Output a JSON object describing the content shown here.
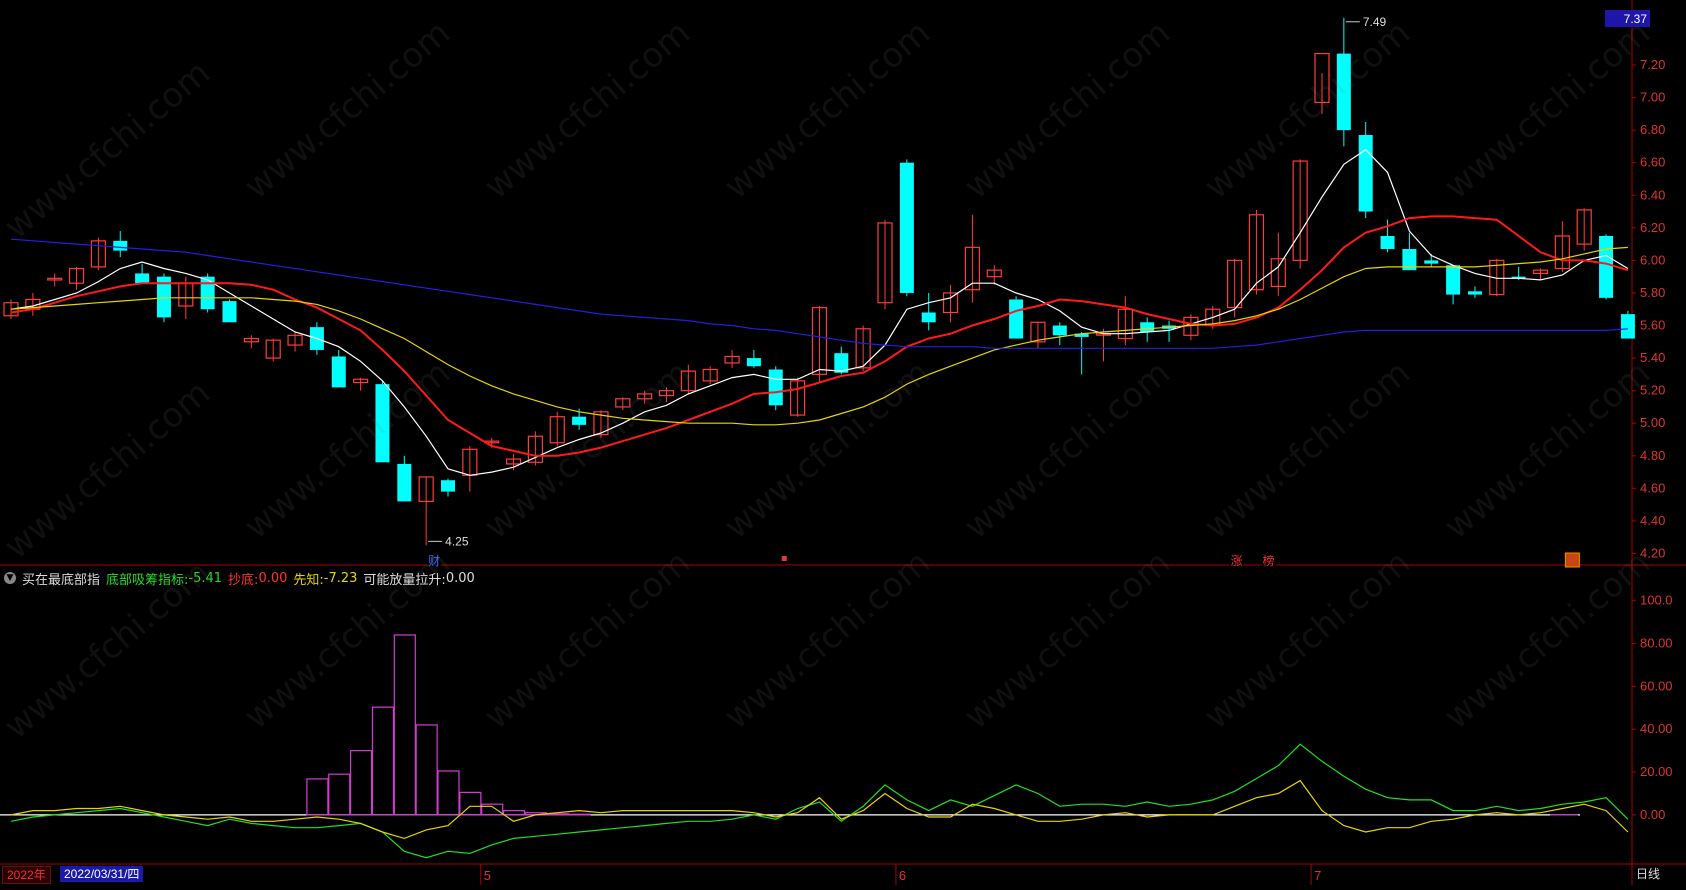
{
  "chart_data": [
    {
      "type": "candlestick",
      "y_axis": {
        "ticks": [
          "7.20",
          "7.00",
          "6.80",
          "6.60",
          "6.40",
          "6.20",
          "6.00",
          "5.80",
          "5.60",
          "5.40",
          "5.20",
          "5.00",
          "4.80",
          "4.60",
          "4.40",
          "4.20"
        ],
        "ylim": [
          4.16,
          7.55
        ]
      },
      "last_price": "7.37",
      "annotations": {
        "high": "7.49",
        "low": "4.25"
      },
      "event_markers": [
        "财",
        "",
        "涨",
        "榜",
        "预"
      ],
      "candles": [
        [
          5.66,
          5.76,
          5.64,
          5.74
        ],
        [
          5.7,
          5.8,
          5.66,
          5.76
        ],
        [
          5.88,
          5.92,
          5.84,
          5.89
        ],
        [
          5.86,
          5.96,
          5.82,
          5.95
        ],
        [
          5.96,
          6.14,
          5.94,
          6.12
        ],
        [
          6.12,
          6.18,
          6.02,
          6.06
        ],
        [
          5.92,
          5.98,
          5.86,
          5.86
        ],
        [
          5.9,
          5.92,
          5.62,
          5.65
        ],
        [
          5.72,
          5.9,
          5.64,
          5.86
        ],
        [
          5.9,
          5.92,
          5.68,
          5.7
        ],
        [
          5.75,
          5.76,
          5.62,
          5.62
        ],
        [
          5.5,
          5.54,
          5.46,
          5.52
        ],
        [
          5.4,
          5.52,
          5.38,
          5.51
        ],
        [
          5.48,
          5.56,
          5.44,
          5.54
        ],
        [
          5.59,
          5.62,
          5.42,
          5.45
        ],
        [
          5.41,
          5.45,
          5.22,
          5.22
        ],
        [
          5.25,
          5.28,
          5.2,
          5.27
        ],
        [
          5.24,
          5.26,
          4.76,
          4.76
        ],
        [
          4.75,
          4.8,
          4.52,
          4.52
        ],
        [
          4.52,
          4.67,
          4.25,
          4.67
        ],
        [
          4.65,
          4.66,
          4.55,
          4.58
        ],
        [
          4.68,
          4.86,
          4.58,
          4.84
        ],
        [
          4.88,
          4.91,
          4.85,
          4.89
        ],
        [
          4.75,
          4.81,
          4.71,
          4.78
        ],
        [
          4.76,
          4.95,
          4.74,
          4.92
        ],
        [
          4.88,
          5.07,
          4.86,
          5.04
        ],
        [
          5.04,
          5.09,
          4.96,
          4.99
        ],
        [
          4.93,
          5.08,
          4.91,
          5.07
        ],
        [
          5.1,
          5.16,
          5.08,
          5.15
        ],
        [
          5.15,
          5.2,
          5.12,
          5.18
        ],
        [
          5.17,
          5.22,
          5.13,
          5.2
        ],
        [
          5.2,
          5.36,
          5.18,
          5.32
        ],
        [
          5.26,
          5.35,
          5.24,
          5.33
        ],
        [
          5.37,
          5.45,
          5.34,
          5.41
        ],
        [
          5.4,
          5.45,
          5.34,
          5.35
        ],
        [
          5.33,
          5.35,
          5.08,
          5.11
        ],
        [
          5.05,
          5.28,
          5.04,
          5.26
        ],
        [
          5.3,
          5.72,
          5.25,
          5.71
        ],
        [
          5.43,
          5.47,
          5.3,
          5.31
        ],
        [
          5.34,
          5.6,
          5.32,
          5.58
        ],
        [
          5.74,
          6.25,
          5.7,
          6.23
        ],
        [
          6.6,
          6.62,
          5.78,
          5.8
        ],
        [
          5.68,
          5.8,
          5.57,
          5.62
        ],
        [
          5.68,
          5.85,
          5.62,
          5.8
        ],
        [
          5.82,
          6.28,
          5.74,
          6.08
        ],
        [
          5.9,
          5.97,
          5.85,
          5.94
        ],
        [
          5.76,
          5.78,
          5.52,
          5.52
        ],
        [
          5.5,
          5.62,
          5.46,
          5.62
        ],
        [
          5.6,
          5.62,
          5.48,
          5.54
        ],
        [
          5.55,
          5.56,
          5.3,
          5.53
        ],
        [
          5.55,
          5.58,
          5.38,
          5.55
        ],
        [
          5.52,
          5.78,
          5.48,
          5.7
        ],
        [
          5.62,
          5.65,
          5.5,
          5.56
        ],
        [
          5.6,
          5.63,
          5.5,
          5.58
        ],
        [
          5.54,
          5.67,
          5.51,
          5.65
        ],
        [
          5.6,
          5.72,
          5.58,
          5.7
        ],
        [
          5.71,
          6.01,
          5.65,
          6.0
        ],
        [
          5.82,
          6.31,
          5.79,
          6.28
        ],
        [
          5.84,
          6.17,
          5.78,
          6.01
        ],
        [
          6.0,
          6.62,
          5.95,
          6.61
        ],
        [
          6.97,
          7.15,
          6.9,
          7.27
        ],
        [
          7.27,
          7.49,
          6.7,
          6.8
        ],
        [
          6.77,
          6.85,
          6.26,
          6.3
        ],
        [
          6.15,
          6.25,
          6.05,
          6.07
        ],
        [
          6.07,
          6.17,
          5.94,
          5.94
        ],
        [
          6.0,
          6.04,
          5.96,
          5.98
        ],
        [
          5.97,
          5.97,
          5.73,
          5.79
        ],
        [
          5.81,
          5.84,
          5.77,
          5.79
        ],
        [
          5.79,
          6.01,
          5.78,
          6.0
        ],
        [
          5.9,
          5.96,
          5.88,
          5.89
        ],
        [
          5.92,
          5.95,
          5.88,
          5.94
        ],
        [
          5.95,
          6.24,
          5.93,
          6.15
        ],
        [
          6.1,
          6.32,
          6.06,
          6.31
        ],
        [
          6.15,
          6.16,
          5.76,
          5.77
        ],
        [
          5.67,
          5.69,
          5.52,
          5.52
        ]
      ],
      "moving_averages": [
        {
          "color": "#ffffff",
          "values": [
            5.7,
            5.72,
            5.76,
            5.8,
            5.87,
            5.95,
            5.99,
            5.95,
            5.92,
            5.88,
            5.8,
            5.72,
            5.64,
            5.56,
            5.52,
            5.47,
            5.38,
            5.26,
            5.1,
            4.92,
            4.72,
            4.68,
            4.7,
            4.73,
            4.79,
            4.85,
            4.9,
            4.94,
            5.0,
            5.07,
            5.11,
            5.18,
            5.23,
            5.28,
            5.3,
            5.27,
            5.27,
            5.33,
            5.32,
            5.35,
            5.48,
            5.7,
            5.74,
            5.77,
            5.86,
            5.86,
            5.8,
            5.76,
            5.69,
            5.59,
            5.55,
            5.55,
            5.56,
            5.57,
            5.61,
            5.65,
            5.7,
            5.86,
            5.96,
            6.17,
            6.39,
            6.59,
            6.68,
            6.54,
            6.18,
            6.03,
            5.97,
            5.92,
            5.89,
            5.89,
            5.88,
            5.91,
            6.0,
            6.03,
            5.95
          ]
        },
        {
          "color": "#ff1a1a",
          "values": [
            5.68,
            5.7,
            5.74,
            5.78,
            5.81,
            5.84,
            5.86,
            5.86,
            5.86,
            5.86,
            5.86,
            5.85,
            5.82,
            5.76,
            5.71,
            5.64,
            5.57,
            5.45,
            5.32,
            5.17,
            5.02,
            4.94,
            4.86,
            4.83,
            4.8,
            4.8,
            4.82,
            4.85,
            4.89,
            4.93,
            4.97,
            5.02,
            5.07,
            5.12,
            5.18,
            5.19,
            5.21,
            5.25,
            5.29,
            5.31,
            5.38,
            5.47,
            5.52,
            5.55,
            5.6,
            5.64,
            5.69,
            5.72,
            5.76,
            5.75,
            5.73,
            5.71,
            5.67,
            5.64,
            5.61,
            5.6,
            5.61,
            5.65,
            5.71,
            5.82,
            5.94,
            6.08,
            6.17,
            6.21,
            6.26,
            6.27,
            6.27,
            6.26,
            6.25,
            6.15,
            6.05,
            6.0,
            6.0,
            5.98,
            5.94
          ]
        },
        {
          "color": "#e8d400",
          "values": [
            5.7,
            5.71,
            5.72,
            5.73,
            5.74,
            5.75,
            5.76,
            5.77,
            5.77,
            5.77,
            5.77,
            5.77,
            5.76,
            5.75,
            5.73,
            5.69,
            5.64,
            5.58,
            5.52,
            5.44,
            5.36,
            5.29,
            5.23,
            5.18,
            5.14,
            5.1,
            5.07,
            5.05,
            5.03,
            5.02,
            5.01,
            5.0,
            5.0,
            5.0,
            4.99,
            4.99,
            5.0,
            5.02,
            5.06,
            5.1,
            5.16,
            5.24,
            5.3,
            5.35,
            5.4,
            5.45,
            5.48,
            5.51,
            5.53,
            5.55,
            5.56,
            5.57,
            5.58,
            5.59,
            5.6,
            5.61,
            5.63,
            5.66,
            5.7,
            5.76,
            5.83,
            5.9,
            5.95,
            5.96,
            5.96,
            5.96,
            5.96,
            5.96,
            5.97,
            5.98,
            5.99,
            6.01,
            6.04,
            6.07,
            6.08
          ]
        },
        {
          "color": "#2020e0",
          "values": [
            6.13,
            6.12,
            6.11,
            6.1,
            6.09,
            6.08,
            6.07,
            6.06,
            6.05,
            6.03,
            6.01,
            5.99,
            5.97,
            5.95,
            5.93,
            5.91,
            5.89,
            5.87,
            5.85,
            5.83,
            5.81,
            5.79,
            5.77,
            5.75,
            5.73,
            5.71,
            5.69,
            5.67,
            5.66,
            5.65,
            5.64,
            5.63,
            5.61,
            5.6,
            5.58,
            5.57,
            5.55,
            5.53,
            5.51,
            5.49,
            5.48,
            5.47,
            5.47,
            5.47,
            5.47,
            5.46,
            5.46,
            5.46,
            5.46,
            5.46,
            5.46,
            5.46,
            5.46,
            5.46,
            5.46,
            5.46,
            5.47,
            5.48,
            5.5,
            5.52,
            5.54,
            5.56,
            5.57,
            5.57,
            5.57,
            5.57,
            5.57,
            5.57,
            5.57,
            5.57,
            5.57,
            5.57,
            5.57,
            5.57,
            5.58
          ]
        }
      ]
    },
    {
      "type": "indicator",
      "indicator_name": "买在最底部指",
      "legend": [
        {
          "label": "底部吸筹指标:",
          "value": "-5.41",
          "color": "#22dd22"
        },
        {
          "label": "抄底:",
          "value": "0.00",
          "color": "#ff3333"
        },
        {
          "label": "先知:",
          "value": "-7.23",
          "color": "#e8d400"
        },
        {
          "label": "可能放量拉升:",
          "value": "0.00",
          "color": "#dddddd"
        }
      ],
      "y_axis": {
        "ticks": [
          "100.0",
          "80.00",
          "60.00",
          "40.00",
          "20.00",
          "0.00"
        ],
        "ylim": [
          -22,
          105
        ]
      },
      "magenta_bars": [
        [
          14,
          16.8
        ],
        [
          15,
          19.0
        ],
        [
          16,
          30.0
        ],
        [
          17,
          50.3
        ],
        [
          18,
          84.0
        ],
        [
          19,
          42.0
        ],
        [
          20,
          20.5
        ],
        [
          21,
          10.5
        ],
        [
          22,
          5.0
        ],
        [
          23,
          2.0
        ],
        [
          24,
          1.0
        ],
        [
          25,
          0.5
        ],
        [
          26,
          0.3
        ]
      ],
      "green_line": [
        -3,
        -1,
        0,
        1,
        2,
        3,
        1,
        -1,
        -3,
        -5,
        -2,
        -4,
        -5,
        -6,
        -6,
        -5,
        -4,
        -8,
        -17,
        -20,
        -17,
        -18,
        -14,
        -11,
        -10,
        -9,
        -8,
        -7,
        -6,
        -5,
        -4,
        -3,
        -3,
        -2,
        0,
        -2,
        3,
        6,
        -3,
        4,
        14,
        7,
        2,
        7,
        4,
        9,
        14,
        10,
        4,
        5,
        5,
        4,
        6,
        4,
        5,
        7,
        11,
        17,
        23,
        33,
        25,
        18,
        12,
        8,
        7,
        7,
        2,
        2,
        4,
        2,
        3,
        5,
        6,
        8,
        -2
      ],
      "yellow_line": [
        0,
        2,
        2,
        3,
        3,
        4,
        2,
        0,
        -1,
        -2,
        -1,
        -3,
        -3,
        -2,
        -1,
        -2,
        -4,
        -8,
        -11,
        -7,
        -5,
        4,
        4,
        -3,
        0,
        1,
        2,
        1,
        2,
        2,
        2,
        2,
        2,
        2,
        1,
        -1,
        1,
        8,
        -2,
        2,
        10,
        3,
        -1,
        -1,
        5,
        3,
        0,
        -3,
        -3,
        -2,
        0,
        1,
        -1,
        0,
        0,
        0,
        4,
        8,
        10,
        16,
        2,
        -5,
        -8,
        -6,
        -6,
        -3,
        -2,
        0,
        1,
        0,
        1,
        3,
        5,
        2,
        -8
      ]
    }
  ],
  "bottom": {
    "year": "2022年",
    "date": "2022/03/31/四",
    "months": [
      "5",
      "6",
      "7"
    ],
    "period": "日线"
  },
  "watermark": "www.cfchi.com"
}
